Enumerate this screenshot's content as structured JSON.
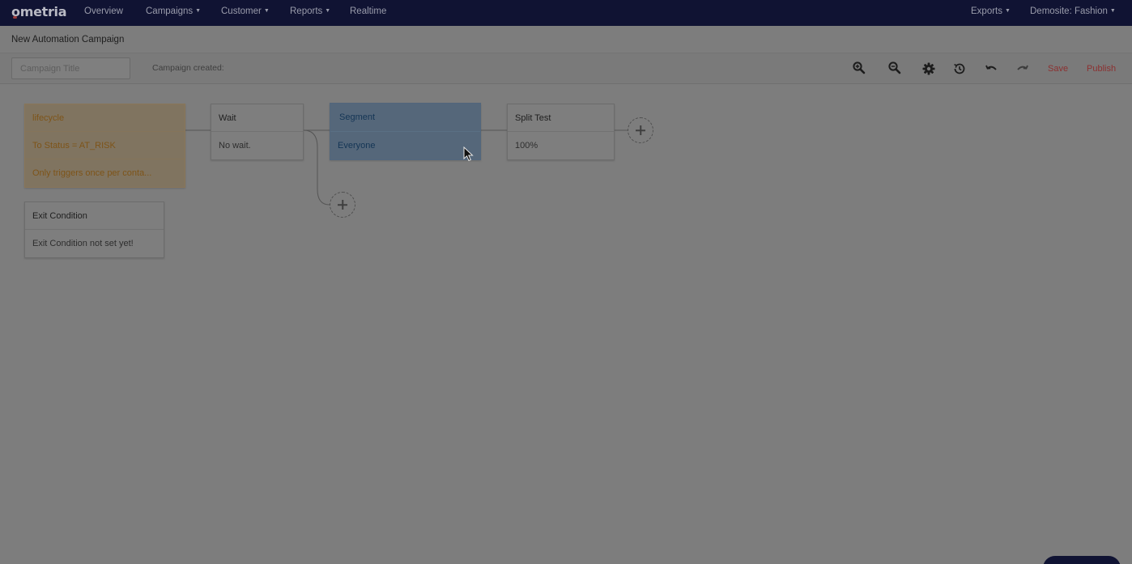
{
  "nav": {
    "logo": "ometria",
    "items": [
      {
        "label": "Overview",
        "dropdown": false
      },
      {
        "label": "Campaigns",
        "dropdown": true
      },
      {
        "label": "Customer",
        "dropdown": true
      },
      {
        "label": "Reports",
        "dropdown": true
      },
      {
        "label": "Realtime",
        "dropdown": false
      }
    ],
    "right": [
      {
        "label": "Exports",
        "dropdown": true
      },
      {
        "label": "Demosite: Fashion",
        "dropdown": true
      }
    ]
  },
  "page": {
    "title": "New Automation Campaign"
  },
  "toolbar": {
    "title_placeholder": "Campaign Title",
    "title_value": "",
    "created_label": "Campaign created:",
    "icons": [
      "zoom-in-icon",
      "zoom-out-icon",
      "gear-icon",
      "history-icon",
      "undo-icon",
      "redo-icon"
    ],
    "save_label": "Save",
    "publish_label": "Publish",
    "action_color": "#8c3030"
  },
  "flow": {
    "trigger": {
      "title": "lifecycle",
      "condition": "To Status = AT_RISK",
      "frequency": "Only triggers once per conta..."
    },
    "wait": {
      "title": "Wait",
      "body": "No wait."
    },
    "segment": {
      "title": "Segment",
      "body": "Everyone"
    },
    "split_test": {
      "title": "Split Test",
      "body": "100%"
    },
    "exit_condition": {
      "title": "Exit Condition",
      "body": "Exit Condition not set yet!"
    }
  },
  "colors": {
    "nav_bg": "#101333",
    "overlay_bg": "#7d7d7d",
    "trigger_accent": "#7e5418",
    "segment_accent": "#143555"
  }
}
